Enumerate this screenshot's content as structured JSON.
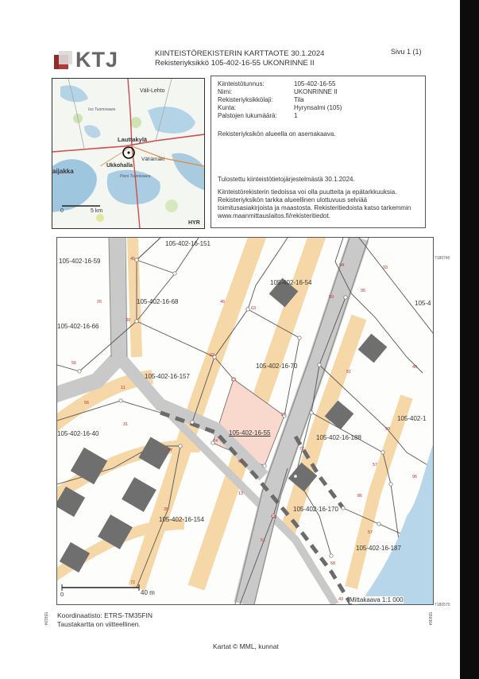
{
  "header": {
    "logo_text": "KTJ",
    "title": "KIINTEISTÖREKISTERIN KARTTAOTE 30.1.2024",
    "subtitle": "Rekisteriyksikkö 105-402-16-55 UKONRINNE II",
    "page": "Sivu 1 (1)"
  },
  "info": {
    "rows": [
      {
        "label": "Kiinteistötunnus:",
        "value": "105-402-16-55"
      },
      {
        "label": "Nimi:",
        "value": "UKONRINNE II"
      },
      {
        "label": "Rekisteriyksikkölaji:",
        "value": "Tila"
      },
      {
        "label": "Kunta:",
        "value": "Hyrynsalmi (105)"
      },
      {
        "label": "Palstojen lukumäärä:",
        "value": "1"
      }
    ],
    "note": "Rekisteriyksikön alueella on asemakaava.",
    "printed": "Tulostettu kiinteistötietojärjestelmästä 30.1.2024.",
    "disclaimer": [
      "Kiinteistörekisterin tiedoissa voi olla puutteita ja epätarkkuuksia.",
      "Rekisteriyksikön tarkka alueellinen ulottuvuus selviää",
      "toimitusasiakirjoista ja maastosta. Rekisteritiedoista katso tarkemmin",
      "www.maanmittauslaitos.fi/rekisteritiedot."
    ]
  },
  "inset_map": {
    "labels": {
      "vali_lehto": "Väli-Lehto",
      "lauttakyla": "Lauttakylä",
      "vahamaki": "Vähämäki",
      "ukkohalla": "Ukkohalla",
      "aijakka": "aijakka",
      "hyr": "HYR",
      "iso_tuomivaara": "Iso Tuomivaara",
      "pieni_tuomivaara": "Pieni Tuomivaara",
      "scale_zero": "0",
      "scale_km": "5 km"
    }
  },
  "main_map": {
    "parcels": {
      "p59": "105-402-16-59",
      "p151": "105-402-16-151",
      "p54": "105-402-16-54",
      "p68": "105-402-16-68",
      "p66": "105-402-16-66",
      "p70": "105-402-16-70",
      "p157": "105-402-16-157",
      "p40": "105-402-16-40",
      "p55": "105-402-16-55",
      "p188": "105-402-16-188",
      "p154": "105-402-16-154",
      "p170": "105-402-16-170",
      "p187": "105-402-16-187",
      "p4r1": "105-4",
      "p4r2": "105-402-1"
    },
    "points": [
      "45",
      "94",
      "93",
      "26",
      "46",
      "59",
      "95",
      "39",
      "63",
      "22",
      "56",
      "40",
      "51",
      "23",
      "11",
      "56",
      "27",
      "31",
      "74",
      "73",
      "57",
      "37",
      "61",
      "99",
      "13",
      "86",
      "35",
      "96",
      "95",
      "57",
      "51",
      "72",
      "58",
      "43"
    ],
    "scale_zero": "0",
    "scale_label": "40 m",
    "mittakaava": "Mittakaava 1:1 000",
    "coord_top": "7180740",
    "coord_bottom": "7180570",
    "coord_left": "559184",
    "coord_right": "559364"
  },
  "footer": {
    "crs": "Koordinaatisto: ETRS-TM35FIN",
    "background": "Taustakartta on viitteellinen.",
    "credits": "Kartat © MML, kunnat"
  }
}
